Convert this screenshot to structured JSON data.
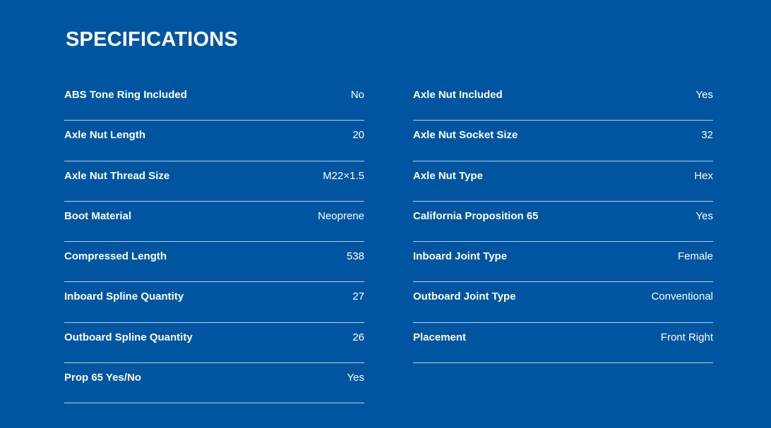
{
  "page": {
    "title": "SPECIFICATIONS"
  },
  "specs": {
    "left": [
      {
        "label": "ABS Tone Ring Included",
        "value": "No"
      },
      {
        "label": "Axle Nut Length",
        "value": "20"
      },
      {
        "label": "Axle Nut Thread Size",
        "value": "M22×1.5"
      },
      {
        "label": "Boot Material",
        "value": "Neoprene"
      },
      {
        "label": "Compressed Length",
        "value": "538"
      },
      {
        "label": "Inboard Spline Quantity",
        "value": "27"
      },
      {
        "label": "Outboard Spline Quantity",
        "value": "26"
      },
      {
        "label": "Prop 65 Yes/No",
        "value": "Yes"
      }
    ],
    "right": [
      {
        "label": "Axle Nut Included",
        "value": "Yes"
      },
      {
        "label": "Axle Nut Socket Size",
        "value": "32"
      },
      {
        "label": "Axle Nut Type",
        "value": "Hex"
      },
      {
        "label": "California Proposition 65",
        "value": "Yes"
      },
      {
        "label": "Inboard Joint Type",
        "value": "Female"
      },
      {
        "label": "Outboard Joint Type",
        "value": "Conventional"
      },
      {
        "label": "Placement",
        "value": "Front Right"
      }
    ]
  },
  "colors": {
    "background": "#0055a0",
    "text": "#ffffff",
    "divider": "#b9cde5"
  }
}
